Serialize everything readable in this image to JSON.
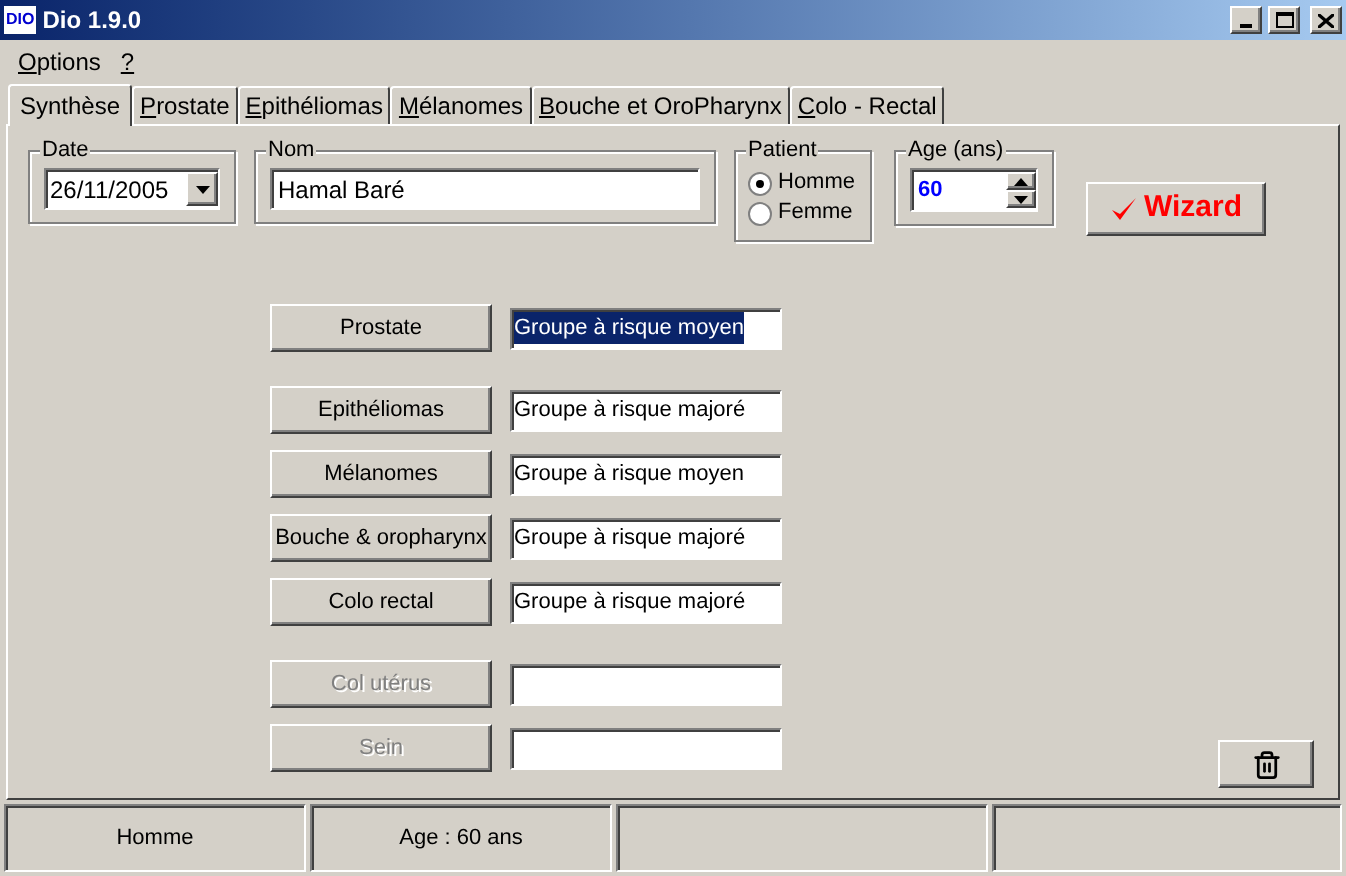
{
  "window": {
    "app_icon": "DIO",
    "title": "Dio 1.9.0"
  },
  "menu": [
    {
      "label": "Options",
      "mnemonic": true
    },
    {
      "label": "?",
      "mnemonic": true
    }
  ],
  "tabs": [
    {
      "label": "Synthèse",
      "selected": true,
      "mnemonic": false
    },
    {
      "label": "Prostate",
      "selected": false,
      "mnemonic": true
    },
    {
      "label": "Epithéliomas",
      "selected": false,
      "mnemonic": true
    },
    {
      "label": "Mélanomes",
      "selected": false,
      "mnemonic": true
    },
    {
      "label": "Bouche et OroPharynx",
      "selected": false,
      "mnemonic": true
    },
    {
      "label": "Colo - Rectal",
      "selected": false,
      "mnemonic": true
    }
  ],
  "date": {
    "label": "Date",
    "value": "26/11/2005"
  },
  "nom": {
    "label": "Nom",
    "value": "Hamal Baré"
  },
  "patient": {
    "label": "Patient",
    "options": [
      {
        "label": "Homme",
        "selected": true
      },
      {
        "label": "Femme",
        "selected": false
      }
    ]
  },
  "age": {
    "label": "Age (ans)",
    "value": "60"
  },
  "wizard_button": {
    "label": "Wizard"
  },
  "risk_groups": [
    [
      {
        "label": "Prostate",
        "value": "Groupe à risque moyen",
        "disabled": false,
        "selected": true
      }
    ],
    [
      {
        "label": "Epithéliomas",
        "value": "Groupe à risque majoré",
        "disabled": false,
        "selected": false
      },
      {
        "label": "Mélanomes",
        "value": "Groupe à risque moyen",
        "disabled": false,
        "selected": false
      },
      {
        "label": "Bouche & oropharynx",
        "value": "Groupe à risque majoré",
        "disabled": false,
        "selected": false
      },
      {
        "label": "Colo rectal",
        "value": "Groupe à risque majoré",
        "disabled": false,
        "selected": false
      }
    ],
    [
      {
        "label": "Col utérus",
        "disabled": true
      },
      {
        "label": "Sein",
        "disabled": true
      }
    ]
  ],
  "status_bar": [
    "Homme",
    "Age : 60 ans"
  ]
}
